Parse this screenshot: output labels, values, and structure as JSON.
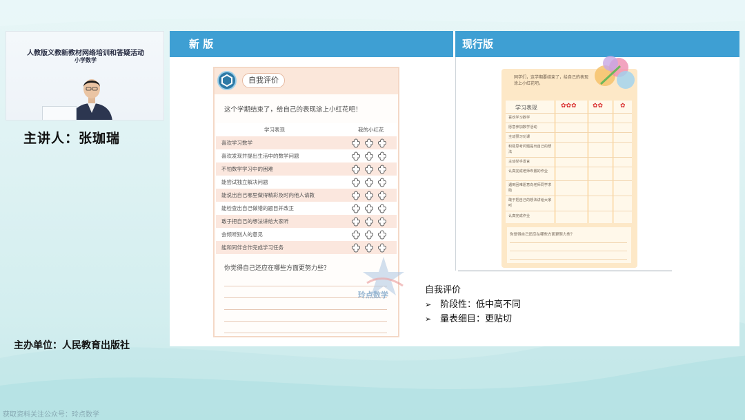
{
  "video": {
    "tiny_text": "",
    "title": "人教版义教新教材网络培训和答疑活动",
    "subtitle": "小学数学"
  },
  "speaker": "主讲人：张珈瑞",
  "organizer": "主办单位：人民教育出版社",
  "slide": {
    "new_label": "新  版",
    "current_label": "现行版",
    "new_book": {
      "badge_title": "自我评价",
      "intro": "这个学期结束了，给自己的表现涂上小红花吧！",
      "col_item": "学习表现",
      "col_flowers": "我的小红花",
      "items": [
        "喜欢学习数学",
        "喜欢发现并提出生活中的数学问题",
        "不怕数学学习中的困难",
        "能尝试独立解决问题",
        "能说出自己哪里做得精彩及时向他人请教",
        "能检查出自己做错的题目并改正",
        "敢于把自己的想法讲给大家听",
        "会倾听别人的意见",
        "能和同伴合作完成学习任务"
      ],
      "question": "你觉得自己还应在哪些方面更努力些？",
      "watermark": "玲点数学"
    },
    "current_book": {
      "intro": "同学们，这学期要结束了，给自己的表现涂上小红花吧。",
      "col_item": "学习表现",
      "items": [
        "喜欢学习数学",
        "愿意参加数学活动",
        "主动预习功课",
        "积极思考问题提出自己的想法",
        "主动举手发言",
        "认真完成老师布置的作业",
        "遇到困难愿意向老师同学求助",
        "敢于把自己的想法讲给大家听",
        "认真完成作业"
      ],
      "question": "你觉得自己还应在哪些方面更努力些？"
    },
    "notes": {
      "title": "自我评价",
      "bullets": [
        "阶段性：低中高不同",
        "量表细目：更贴切"
      ]
    }
  },
  "footer": "获取资料关注公众号：玲点数学",
  "colors": {
    "accent": "#3e9fd3",
    "flower": "#d92a2a",
    "new_row": "#fbe7de",
    "old_page": "#fde8c7"
  }
}
